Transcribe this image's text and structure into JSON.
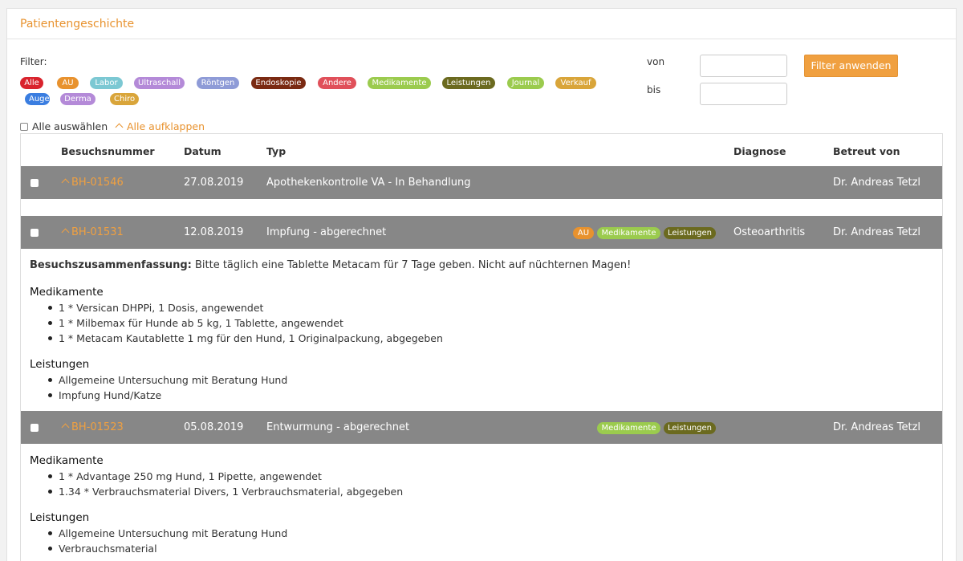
{
  "panel": {
    "title": "Patientengeschichte"
  },
  "filter": {
    "label": "Filter:",
    "tags": [
      {
        "label": "Alle",
        "color": "#d9232d"
      },
      {
        "label": "AU",
        "color": "#e8922e"
      },
      {
        "label": "Labor",
        "color": "#7cc8d3"
      },
      {
        "label": "Ultraschall",
        "color": "#b48ad8"
      },
      {
        "label": "Röntgen",
        "color": "#8e9bd7"
      },
      {
        "label": "Endoskopie",
        "color": "#7a2a12"
      },
      {
        "label": "Andere",
        "color": "#e0505a"
      },
      {
        "label": "Medikamente",
        "color": "#9bcb4e"
      },
      {
        "label": "Leistungen",
        "color": "#6b6a1f"
      },
      {
        "label": "Journal",
        "color": "#9bcb4e"
      },
      {
        "label": "Verkauf",
        "color": "#d9a53a"
      },
      {
        "label": "Auge",
        "color": "#3a7de0"
      },
      {
        "label": "Derma",
        "color": "#b48ad8"
      },
      {
        "label": "Chiro",
        "color": "#d9a53a"
      }
    ],
    "von_label": "von",
    "bis_label": "bis",
    "von_value": "",
    "bis_value": "",
    "apply_label": "Filter anwenden",
    "select_all_label": "Alle auswählen",
    "expand_all_label": "Alle aufklappen"
  },
  "table": {
    "headers": {
      "visit": "Besuchsnummer",
      "date": "Datum",
      "type": "Typ",
      "diagnosis": "Diagnose",
      "vet": "Betreut von"
    },
    "rows": [
      {
        "visit": "BH-01546",
        "date": "27.08.2019",
        "type": "Apothekenkontrolle VA - In Behandlung",
        "tags": [],
        "diagnosis": "",
        "vet": "Dr. Andreas Tetzl"
      },
      {
        "visit": "BH-01531",
        "date": "12.08.2019",
        "type": "Impfung - abgerechnet",
        "tags": [
          {
            "label": "AU",
            "color": "#e8922e"
          },
          {
            "label": "Medikamente",
            "color": "#9bcb4e"
          },
          {
            "label": "Leistungen",
            "color": "#6b6a1f"
          }
        ],
        "diagnosis": "Osteoarthritis",
        "vet": "Dr. Andreas Tetzl",
        "summary_label": "Besuchszusammenfassung:",
        "summary_text": "Bitte täglich eine Tablette Metacam für 7 Tage geben. Nicht auf nüchternen Magen!",
        "medikamente_title": "Medikamente",
        "medikamente": [
          "1 * Versican DHPPi, 1 Dosis, angewendet",
          "1 * Milbemax für Hunde ab 5 kg, 1 Tablette, angewendet",
          "1 * Metacam Kautablette 1 mg für den Hund, 1 Originalpackung, abgegeben"
        ],
        "leistungen_title": "Leistungen",
        "leistungen": [
          "Allgemeine Untersuchung mit Beratung Hund",
          "Impfung Hund/Katze"
        ]
      },
      {
        "visit": "BH-01523",
        "date": "05.08.2019",
        "type": "Entwurmung - abgerechnet",
        "tags": [
          {
            "label": "Medikamente",
            "color": "#9bcb4e"
          },
          {
            "label": "Leistungen",
            "color": "#6b6a1f"
          }
        ],
        "diagnosis": "",
        "vet": "Dr. Andreas Tetzl",
        "medikamente_title": "Medikamente",
        "medikamente": [
          "1 * Advantage 250 mg Hund, 1 Pipette, angewendet",
          "1.34 * Verbrauchsmaterial Divers, 1 Verbrauchsmaterial, abgegeben"
        ],
        "leistungen_title": "Leistungen",
        "leistungen": [
          "Allgemeine Untersuchung mit Beratung Hund",
          "Verbrauchsmaterial"
        ]
      }
    ]
  },
  "icons": {
    "expand": "chevron-up-icon",
    "checkbox": "checkbox-icon"
  },
  "colors": {
    "accent": "#e8922e",
    "row_bg": "#878787"
  }
}
